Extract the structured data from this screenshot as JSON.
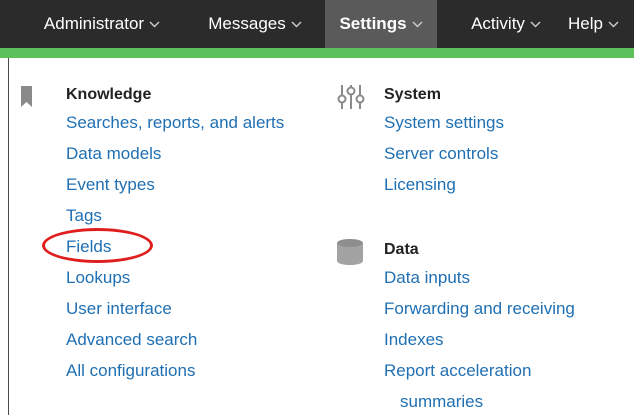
{
  "nav": {
    "items": [
      {
        "label": "Administrator",
        "active": false
      },
      {
        "label": "Messages",
        "active": false
      },
      {
        "label": "Settings",
        "active": true
      },
      {
        "label": "Activity",
        "active": false
      },
      {
        "label": "Help",
        "active": false
      }
    ],
    "accent_color": "#5cc05c",
    "bar_color": "#2b2b2b"
  },
  "menu": {
    "knowledge": {
      "title": "Knowledge",
      "icon": "bookmark-icon",
      "items": [
        "Searches, reports, and alerts",
        "Data models",
        "Event types",
        "Tags",
        "Fields",
        "Lookups",
        "User interface",
        "Advanced search",
        "All configurations"
      ]
    },
    "system": {
      "title": "System",
      "icon": "sliders-icon",
      "items": [
        "System settings",
        "Server controls",
        "Licensing"
      ]
    },
    "data": {
      "title": "Data",
      "icon": "database-icon",
      "items": [
        "Data inputs",
        "Forwarding and receiving",
        "Indexes",
        "Report acceleration",
        "summaries"
      ]
    }
  },
  "annotation": {
    "highlighted_item": "Fields",
    "color": "#e01e1e"
  }
}
